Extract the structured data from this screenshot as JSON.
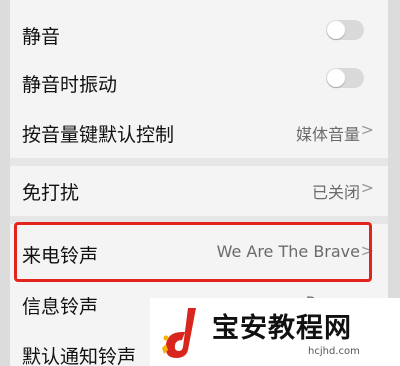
{
  "settings": {
    "mute": {
      "label": "静音",
      "toggle": "off"
    },
    "vibrate_on_mute": {
      "label": "静音时振动",
      "toggle": "off"
    },
    "volume_key": {
      "label": "按音量键默认控制",
      "value": "媒体音量"
    },
    "dnd": {
      "label": "免打扰",
      "value": "已关闭"
    },
    "ringtone": {
      "label": "来电铃声",
      "value": "We Are The Brave"
    },
    "message_tone": {
      "label": "信息铃声",
      "value": "Pong..."
    },
    "notification_tone": {
      "label": "默认通知铃声"
    },
    "chevron": ">"
  },
  "watermark": {
    "title": "宝安教程网",
    "url": "hcjhd.com"
  },
  "colors": {
    "highlight": "#e3241b",
    "logo": "#d8261d"
  }
}
